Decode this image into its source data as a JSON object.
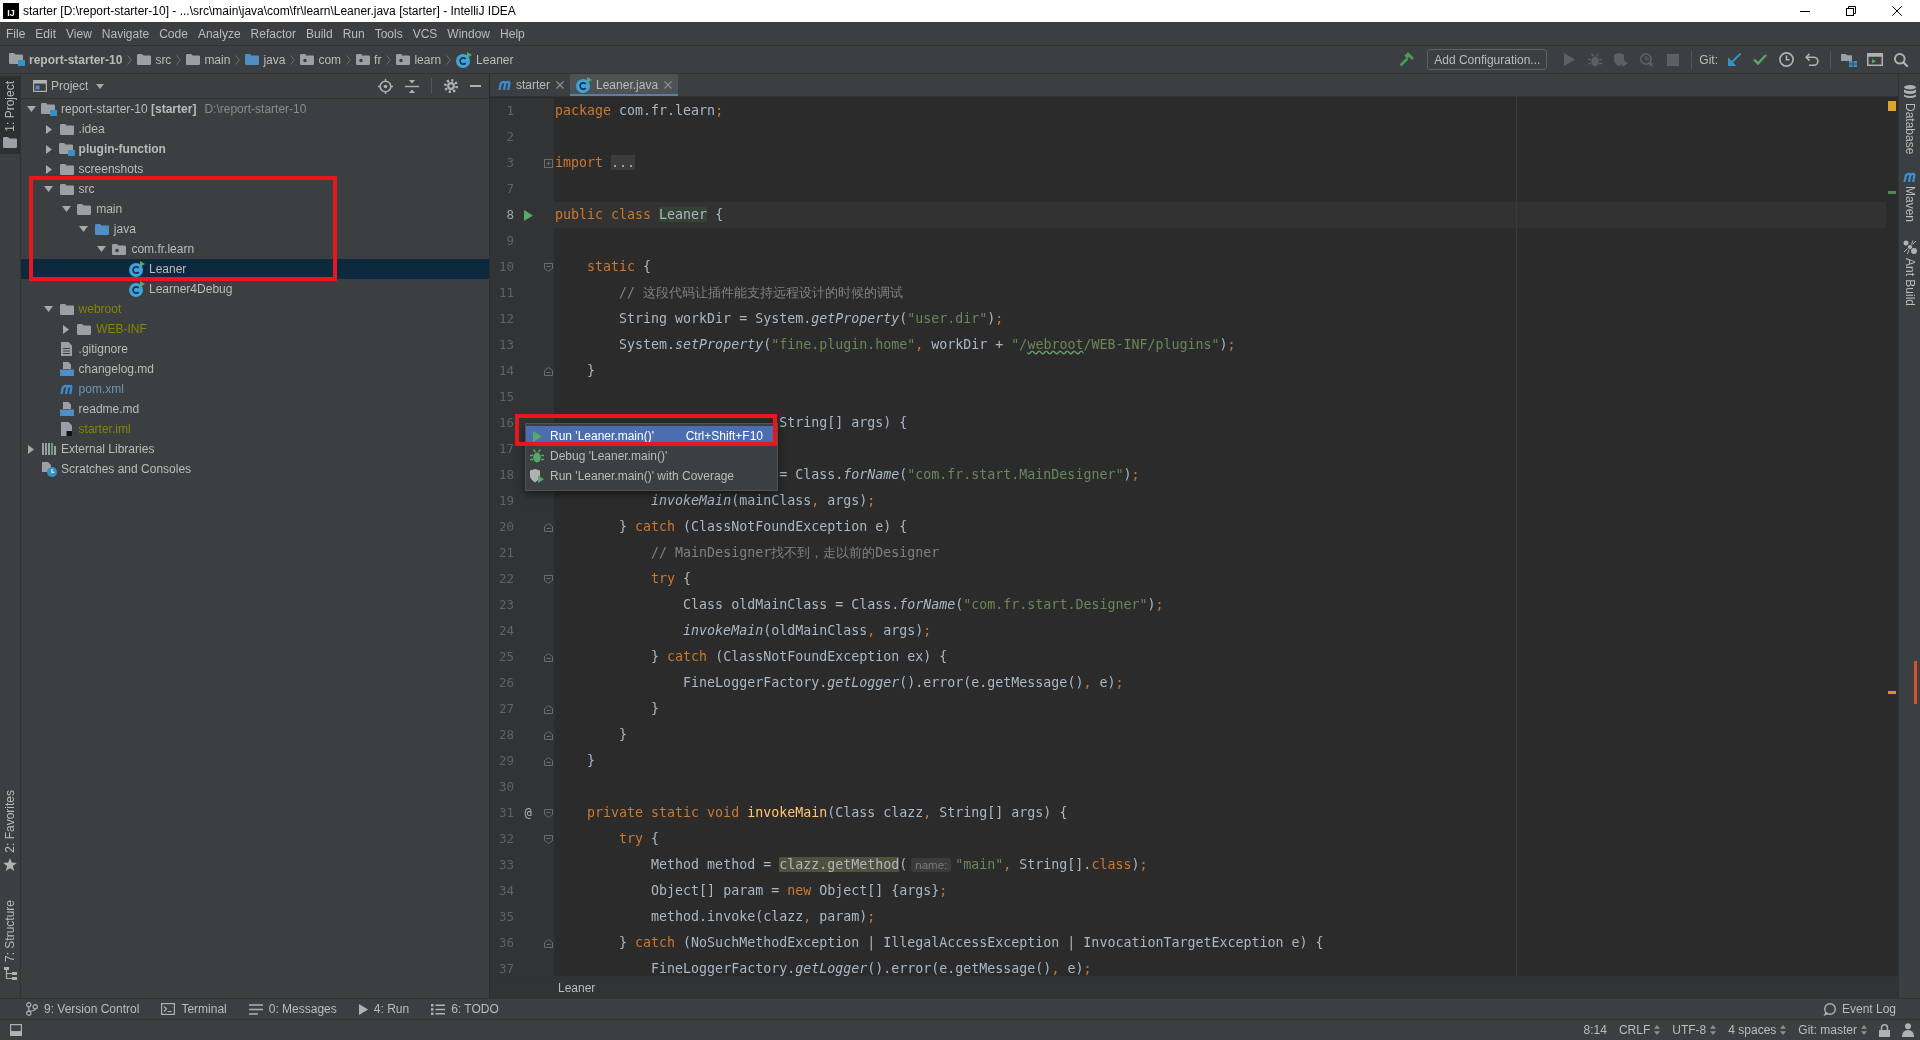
{
  "window": {
    "app_icon_text": "IJ",
    "title": "starter [D:\\report-starter-10] - ...\\src\\main\\java\\com\\fr\\learn\\Leaner.java [starter] - IntelliJ IDEA"
  },
  "menu": [
    "File",
    "Edit",
    "View",
    "Navigate",
    "Code",
    "Analyze",
    "Refactor",
    "Build",
    "Run",
    "Tools",
    "VCS",
    "Window",
    "Help"
  ],
  "navigation_bar": [
    {
      "kind": "module",
      "label": "report-starter-10"
    },
    {
      "kind": "folder",
      "label": "src"
    },
    {
      "kind": "folder",
      "label": "main"
    },
    {
      "kind": "source_folder",
      "label": "java"
    },
    {
      "kind": "package",
      "label": "com"
    },
    {
      "kind": "package",
      "label": "fr"
    },
    {
      "kind": "package",
      "label": "learn"
    },
    {
      "kind": "class",
      "label": "Leaner"
    }
  ],
  "toolbar": [
    {
      "items": [
        {
          "kind": "build",
          "disabled": false
        },
        {
          "kind": "configuration",
          "label": "Add Configuration..."
        },
        {
          "kind": "run",
          "disabled": true
        },
        {
          "kind": "debug",
          "disabled": true
        },
        {
          "kind": "coverage",
          "disabled": true
        },
        {
          "kind": "profile",
          "disabled": true
        },
        {
          "kind": "stop",
          "disabled": true
        }
      ]
    },
    {
      "items": [
        {
          "kind": "label",
          "label": "Git:"
        },
        {
          "kind": "update",
          "disabled": false
        },
        {
          "kind": "commit",
          "disabled": false
        },
        {
          "kind": "history",
          "disabled": false
        },
        {
          "kind": "rollback",
          "disabled": false
        }
      ]
    },
    {
      "items": [
        {
          "kind": "structure",
          "disabled": false
        },
        {
          "kind": "layout",
          "disabled": false
        },
        {
          "kind": "search",
          "disabled": false
        }
      ]
    }
  ],
  "left_stripe": {
    "top": [
      {
        "kind": "project",
        "label": "1: Project",
        "selected": true
      }
    ],
    "bottom": [
      {
        "kind": "favorites",
        "label": "2: Favorites",
        "selected": false
      },
      {
        "kind": "structure",
        "label": "7: Structure",
        "selected": false
      }
    ]
  },
  "project_panel": {
    "title": "Project",
    "tree": [
      {
        "label": "report-starter-10 **[starter]**",
        "location": "D:\\report-starter-10",
        "kind": "project",
        "color": "#bbbbbb",
        "selected": false,
        "expanded": true,
        "children": [
          {
            "label": ".idea",
            "kind": "folder",
            "color": "#bbbbbb",
            "selected": false,
            "expanded": false
          },
          {
            "label": "plugin-function",
            "kind": "module",
            "color": "#bbbbbb",
            "selected": false,
            "expanded": false
          },
          {
            "label": "screenshots",
            "kind": "folder",
            "color": "#bbbbbb",
            "selected": false,
            "expanded": false
          },
          {
            "label": "src",
            "kind": "folder",
            "color": "#bbbbbb",
            "selected": false,
            "expanded": true,
            "children": [
              {
                "label": "main",
                "kind": "folder",
                "color": "#bbbbbb",
                "selected": false,
                "expanded": true,
                "children": [
                  {
                    "label": "java",
                    "kind": "source_folder",
                    "color": "#bbbbbb",
                    "selected": false,
                    "expanded": true,
                    "children": [
                      {
                        "label": "com.fr.learn",
                        "kind": "package",
                        "color": "#bbbbbb",
                        "selected": false,
                        "expanded": true,
                        "children": [
                          {
                            "label": "Leaner",
                            "kind": "class",
                            "color": "#bbbbbb",
                            "selected": true
                          },
                          {
                            "label": "Learner4Debug",
                            "kind": "class",
                            "color": "#bbbbbb",
                            "selected": false
                          }
                        ]
                      }
                    ]
                  }
                ]
              }
            ]
          },
          {
            "label": "webroot",
            "kind": "folder",
            "color": "#848504",
            "selected": false,
            "expanded": true,
            "children": [
              {
                "label": "WEB-INF",
                "kind": "folder",
                "color": "#848504",
                "selected": false,
                "expanded": false
              }
            ]
          },
          {
            "label": ".gitignore",
            "kind": "text_file",
            "color": "#bbbbbb",
            "selected": false
          },
          {
            "label": "changelog.md",
            "kind": "markdown_file",
            "color": "#bbbbbb",
            "selected": false
          },
          {
            "label": "pom.xml",
            "kind": "maven_file",
            "color": "#6897bb",
            "selected": false
          },
          {
            "label": "readme.md",
            "kind": "markdown_file",
            "color": "#bbbbbb",
            "selected": false
          },
          {
            "label": "starter.iml",
            "kind": "module_file",
            "color": "#848504",
            "selected": false
          }
        ]
      },
      {
        "label": "External Libraries",
        "kind": "libraries",
        "color": "#bbbbbb",
        "selected": false,
        "expanded": false
      },
      {
        "label": "Scratches and Consoles",
        "kind": "scratches",
        "color": "#bbbbbb",
        "selected": false
      }
    ],
    "annotations": [
      {
        "kind": "frame"
      }
    ]
  },
  "editor": {
    "tabs": [
      {
        "kind": "maven",
        "label": "starter",
        "selected": false
      },
      {
        "kind": "class",
        "label": "Leaner.java",
        "selected": true
      }
    ],
    "lines": [
      {
        "number": "1",
        "current": false,
        "kind": "plain",
        "tokens": [
          {
            "kind": "keyword",
            "text": "package"
          },
          {
            "kind": "plain",
            "text": " com.fr.learn"
          },
          {
            "kind": "punct",
            "text": ";"
          }
        ]
      },
      {
        "number": "2",
        "current": false,
        "kind": "plain"
      },
      {
        "number": "3",
        "current": false,
        "kind": "fold_collapsed",
        "tokens": [
          {
            "kind": "keyword",
            "text": "import "
          },
          {
            "kind": "folded",
            "text": "..."
          }
        ]
      },
      {
        "number": "7",
        "current": false,
        "kind": "plain"
      },
      {
        "number": "8",
        "current": true,
        "kind": "runnable",
        "tokens": [
          {
            "kind": "keyword",
            "text": "public class "
          },
          {
            "kind": "usage",
            "text": "Leaner"
          },
          {
            "kind": "plain",
            "text": " {"
          }
        ]
      },
      {
        "number": "9",
        "current": false,
        "kind": "plain"
      },
      {
        "number": "10",
        "current": false,
        "kind": "fold_start",
        "tokens": [
          {
            "kind": "keyword",
            "text": "    static"
          },
          {
            "kind": "plain",
            "text": " {"
          }
        ]
      },
      {
        "number": "11",
        "current": false,
        "kind": "plain",
        "tokens": [
          {
            "kind": "comment",
            "text": "        // 这段代码让插件能支持远程设计的时候的调试"
          }
        ]
      },
      {
        "number": "12",
        "current": false,
        "kind": "plain",
        "tokens": [
          {
            "kind": "plain",
            "text": "        String workDir = System."
          },
          {
            "kind": "static_call",
            "text": "getProperty"
          },
          {
            "kind": "plain",
            "text": "("
          },
          {
            "kind": "string",
            "text": "\"user.dir\""
          },
          {
            "kind": "plain",
            "text": ")"
          },
          {
            "kind": "punct",
            "text": ";"
          }
        ]
      },
      {
        "number": "13",
        "current": false,
        "kind": "plain",
        "tokens": [
          {
            "kind": "plain",
            "text": "        System."
          },
          {
            "kind": "static_call",
            "text": "setProperty"
          },
          {
            "kind": "plain",
            "text": "("
          },
          {
            "kind": "string",
            "text": "\"fine.plugin.home\""
          },
          {
            "kind": "punct",
            "text": ","
          },
          {
            "kind": "plain",
            "text": " workDir + "
          },
          {
            "kind": "string",
            "text": "\"/"
          },
          {
            "kind": "typo",
            "text": "webroot"
          },
          {
            "kind": "string",
            "text": "/WEB-INF/plugins\""
          },
          {
            "kind": "plain",
            "text": ")"
          },
          {
            "kind": "punct",
            "text": ";"
          }
        ]
      },
      {
        "number": "14",
        "current": false,
        "kind": "fold_end",
        "tokens": [
          {
            "kind": "plain",
            "text": "    }"
          }
        ]
      },
      {
        "number": "15",
        "current": false,
        "kind": "plain"
      },
      {
        "number": "16",
        "current": false,
        "kind": "plain",
        "tokens": [
          {
            "kind": "plain",
            "text": "                            String[] args) {"
          }
        ]
      },
      {
        "number": "17",
        "current": false,
        "kind": "plain"
      },
      {
        "number": "18",
        "current": false,
        "kind": "plain",
        "tokens": [
          {
            "kind": "plain",
            "text": "                            = Class."
          },
          {
            "kind": "static_call",
            "text": "forName"
          },
          {
            "kind": "plain",
            "text": "("
          },
          {
            "kind": "string",
            "text": "\"com.fr.start.MainDesigner\""
          },
          {
            "kind": "plain",
            "text": ")"
          },
          {
            "kind": "punct",
            "text": ";"
          }
        ]
      },
      {
        "number": "19",
        "current": false,
        "kind": "plain",
        "tokens": [
          {
            "kind": "static_call",
            "text": "            invokeMain"
          },
          {
            "kind": "plain",
            "text": "(mainClass"
          },
          {
            "kind": "punct",
            "text": ","
          },
          {
            "kind": "plain",
            "text": " args)"
          },
          {
            "kind": "punct",
            "text": ";"
          }
        ]
      },
      {
        "number": "20",
        "current": false,
        "kind": "fold_end",
        "tokens": [
          {
            "kind": "plain",
            "text": "        } "
          },
          {
            "kind": "keyword",
            "text": "catch"
          },
          {
            "kind": "plain",
            "text": " (ClassNotFoundException e) {"
          }
        ]
      },
      {
        "number": "21",
        "current": false,
        "kind": "plain",
        "tokens": [
          {
            "kind": "comment",
            "text": "            // MainDesigner找不到，走以前的Designer"
          }
        ]
      },
      {
        "number": "22",
        "current": false,
        "kind": "fold_start",
        "tokens": [
          {
            "kind": "keyword",
            "text": "            try"
          },
          {
            "kind": "plain",
            "text": " {"
          }
        ]
      },
      {
        "number": "23",
        "current": false,
        "kind": "plain",
        "tokens": [
          {
            "kind": "plain",
            "text": "                Class oldMainClass = Class."
          },
          {
            "kind": "static_call",
            "text": "forName"
          },
          {
            "kind": "plain",
            "text": "("
          },
          {
            "kind": "string",
            "text": "\"com.fr.start.Designer\""
          },
          {
            "kind": "plain",
            "text": ")"
          },
          {
            "kind": "punct",
            "text": ";"
          }
        ]
      },
      {
        "number": "24",
        "current": false,
        "kind": "plain",
        "tokens": [
          {
            "kind": "static_call",
            "text": "                invokeMain"
          },
          {
            "kind": "plain",
            "text": "(oldMainClass"
          },
          {
            "kind": "punct",
            "text": ","
          },
          {
            "kind": "plain",
            "text": " args)"
          },
          {
            "kind": "punct",
            "text": ";"
          }
        ]
      },
      {
        "number": "25",
        "current": false,
        "kind": "fold_end",
        "tokens": [
          {
            "kind": "plain",
            "text": "            } "
          },
          {
            "kind": "keyword",
            "text": "catch"
          },
          {
            "kind": "plain",
            "text": " (ClassNotFoundException ex) {"
          }
        ]
      },
      {
        "number": "26",
        "current": false,
        "kind": "plain",
        "tokens": [
          {
            "kind": "plain",
            "text": "                FineLoggerFactory."
          },
          {
            "kind": "static_call",
            "text": "getLogger"
          },
          {
            "kind": "plain",
            "text": "().error(e.getMessage()"
          },
          {
            "kind": "punct",
            "text": ","
          },
          {
            "kind": "plain",
            "text": " e)"
          },
          {
            "kind": "punct",
            "text": ";"
          }
        ]
      },
      {
        "number": "27",
        "current": false,
        "kind": "fold_end",
        "tokens": [
          {
            "kind": "plain",
            "text": "            }"
          }
        ]
      },
      {
        "number": "28",
        "current": false,
        "kind": "fold_end",
        "tokens": [
          {
            "kind": "plain",
            "text": "        }"
          }
        ]
      },
      {
        "number": "29",
        "current": false,
        "kind": "fold_end",
        "tokens": [
          {
            "kind": "plain",
            "text": "    }"
          }
        ]
      },
      {
        "number": "30",
        "current": false,
        "kind": "plain"
      },
      {
        "number": "31",
        "current": false,
        "kind": "fold_start",
        "gutter_mark": "@",
        "tokens": [
          {
            "kind": "keyword",
            "text": "    private static void "
          },
          {
            "kind": "declaration",
            "text": "invokeMain"
          },
          {
            "kind": "plain",
            "text": "(Class clazz"
          },
          {
            "kind": "punct",
            "text": ","
          },
          {
            "kind": "plain",
            "text": " String[] args) {"
          }
        ]
      },
      {
        "number": "32",
        "current": false,
        "kind": "fold_start",
        "tokens": [
          {
            "kind": "keyword",
            "text": "        try"
          },
          {
            "kind": "plain",
            "text": " {"
          }
        ]
      },
      {
        "number": "33",
        "current": false,
        "kind": "plain",
        "tokens": [
          {
            "kind": "plain",
            "text": "            Method method = "
          },
          {
            "kind": "warning",
            "text": "clazz.getMethod"
          },
          {
            "kind": "plain",
            "text": "("
          },
          {
            "kind": "hint",
            "text": "name:"
          },
          {
            "kind": "string",
            "text": "\"main\""
          },
          {
            "kind": "punct",
            "text": ","
          },
          {
            "kind": "plain",
            "text": " String[]."
          },
          {
            "kind": "keyword",
            "text": "class"
          },
          {
            "kind": "plain",
            "text": ")"
          },
          {
            "kind": "punct",
            "text": ";"
          }
        ]
      },
      {
        "number": "34",
        "current": false,
        "kind": "plain",
        "tokens": [
          {
            "kind": "plain",
            "text": "            Object[] param = "
          },
          {
            "kind": "keyword",
            "text": "new"
          },
          {
            "kind": "plain",
            "text": " Object[] {args}"
          },
          {
            "kind": "punct",
            "text": ";"
          }
        ]
      },
      {
        "number": "35",
        "current": false,
        "kind": "plain",
        "tokens": [
          {
            "kind": "plain",
            "text": "            method.invoke(clazz"
          },
          {
            "kind": "punct",
            "text": ","
          },
          {
            "kind": "plain",
            "text": " param)"
          },
          {
            "kind": "punct",
            "text": ";"
          }
        ]
      },
      {
        "number": "36",
        "current": false,
        "kind": "fold_end",
        "tokens": [
          {
            "kind": "plain",
            "text": "        } "
          },
          {
            "kind": "keyword",
            "text": "catch"
          },
          {
            "kind": "plain",
            "text": " (NoSuchMethodException | IllegalAccessException | InvocationTargetException e) {"
          }
        ]
      },
      {
        "number": "37",
        "current": false,
        "kind": "plain",
        "tokens": [
          {
            "kind": "plain",
            "text": "            FineLoggerFactory."
          },
          {
            "kind": "static_call",
            "text": "getLogger"
          },
          {
            "kind": "plain",
            "text": "().error(e.getMessage()"
          },
          {
            "kind": "punct",
            "text": ","
          },
          {
            "kind": "plain",
            "text": " e)"
          },
          {
            "kind": "punct",
            "text": ";"
          }
        ]
      }
    ],
    "breadcrumb": "Leaner"
  },
  "context_menu": {
    "items": [
      {
        "kind": "run",
        "label": "Run 'Leaner.main()'",
        "shortcut": "Ctrl+Shift+F10",
        "selected": true
      },
      {
        "kind": "debug",
        "label": "Debug 'Leaner.main()'",
        "selected": false
      },
      {
        "kind": "coverage",
        "label": "Run 'Leaner.main()' with Coverage",
        "selected": false
      }
    ],
    "annotations": [
      {
        "kind": "frame"
      }
    ]
  },
  "right_stripe": [
    {
      "kind": "database",
      "label": "Database"
    },
    {
      "kind": "maven",
      "label": "Maven"
    },
    {
      "kind": "ant",
      "label": "Ant Build"
    }
  ],
  "tool_window_bar": {
    "left": [
      {
        "kind": "vcs",
        "label": "9: Version Control"
      },
      {
        "kind": "terminal",
        "label": "Terminal"
      },
      {
        "kind": "messages",
        "label": "0: Messages"
      },
      {
        "kind": "run",
        "label": "4: Run"
      },
      {
        "kind": "todo",
        "label": "6: TODO"
      }
    ],
    "right": [
      {
        "kind": "event_log",
        "label": "Event Log"
      }
    ]
  },
  "status_bar": {
    "items": [
      {
        "kind": "text",
        "label": "8:14"
      },
      {
        "kind": "choice",
        "label": "CRLF"
      },
      {
        "kind": "choice",
        "label": "UTF-8"
      },
      {
        "kind": "choice",
        "label": "4 spaces"
      },
      {
        "kind": "choice",
        "label": "Git: master"
      }
    ]
  }
}
